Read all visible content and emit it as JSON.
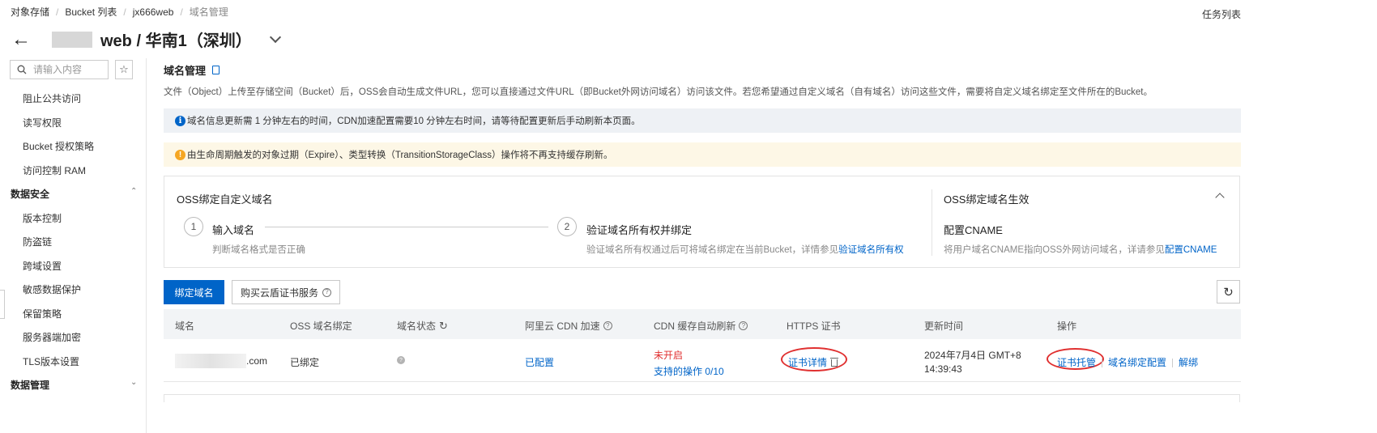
{
  "breadcrumb": [
    "对象存储",
    "Bucket 列表",
    "jx666web",
    "域名管理"
  ],
  "task_list": "任务列表",
  "header": {
    "title": "web / 华南1（深圳）"
  },
  "sidebar": {
    "search_placeholder": "请输入内容",
    "items": [
      "阻止公共访问",
      "读写权限",
      "Bucket 授权策略",
      "访问控制 RAM"
    ],
    "group_data_security": "数据安全",
    "security_items": [
      "版本控制",
      "防盗链",
      "跨域设置",
      "敏感数据保护",
      "保留策略",
      "服务器端加密",
      "TLS版本设置"
    ],
    "group_data_management": "数据管理"
  },
  "main": {
    "title": "域名管理",
    "description": "文件（Object）上传至存储空间（Bucket）后，OSS会自动生成文件URL，您可以直接通过文件URL（即Bucket外网访问域名）访问该文件。若您希望通过自定义域名（自有域名）访问这些文件，需要将自定义域名绑定至文件所在的Bucket。",
    "info": "域名信息更新需 1 分钟左右的时间，CDN加速配置需要10 分钟左右时间，请等待配置更新后手动刷新本页面。",
    "warning": "由生命周期触发的对象过期（Expire）、类型转换（TransitionStorageClass）操作将不再支持缓存刷新。",
    "steps_card": {
      "title": "OSS绑定自定义域名",
      "step1_num": "1",
      "step1_label": "输入域名",
      "step1_desc": "判断域名格式是否正确",
      "step2_num": "2",
      "step2_label": "验证域名所有权并绑定",
      "step2_desc": "验证域名所有权通过后可将域名绑定在当前Bucket，详情参见",
      "step2_link": "验证域名所有权",
      "right_title": "OSS绑定域名生效",
      "right_sub": "配置CNAME",
      "right_desc": "将用户域名CNAME指向OSS外网访问域名，详请参见",
      "right_link": "配置CNAME"
    },
    "buttons": {
      "bind": "绑定域名",
      "buy_cert": "购买云盾证书服务"
    },
    "table": {
      "headers": [
        "域名",
        "OSS 域名绑定",
        "域名状态",
        "阿里云 CDN 加速",
        "CDN 缓存自动刷新",
        "HTTPS 证书",
        "更新时间",
        "操作"
      ],
      "rows": [
        {
          "domain_suffix": ".com",
          "oss_binding": "已绑定",
          "cdn": "已配置",
          "cdn_refresh_status": "未开启",
          "cdn_refresh_ops": "支持的操作 0/10",
          "https_cert": "证书详情",
          "updated_line1": "2024年7月4日 GMT+8",
          "updated_line2": "14:39:43",
          "actions": [
            "证书托管",
            "域名绑定配置",
            "解绑"
          ]
        }
      ]
    }
  },
  "colors": {
    "primary": "#0064c8",
    "danger": "#e03030",
    "warn": "#f5a623"
  }
}
